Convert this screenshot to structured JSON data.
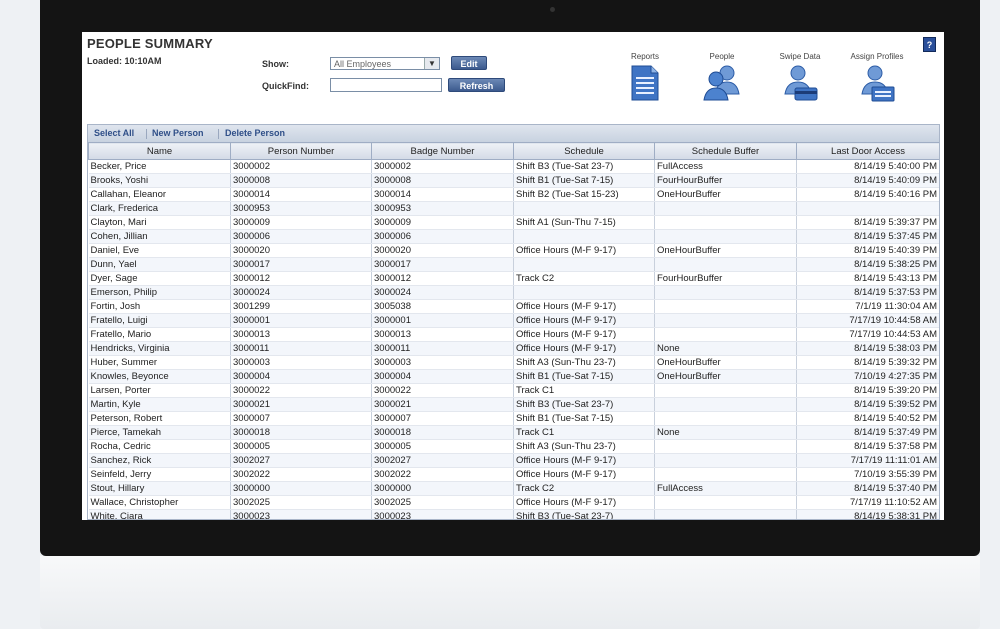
{
  "header": {
    "title": "PEOPLE SUMMARY",
    "loaded": "Loaded: 10:10AM"
  },
  "filters": {
    "show_label": "Show:",
    "show_value": "All Employees",
    "edit_label": "Edit",
    "quickfind_label": "QuickFind:",
    "quickfind_value": "",
    "refresh_label": "Refresh"
  },
  "nav": [
    {
      "label": "Reports",
      "icon": "reports-icon"
    },
    {
      "label": "People",
      "icon": "people-icon"
    },
    {
      "label": "Swipe Data",
      "icon": "swipe-data-icon"
    },
    {
      "label": "Assign Profiles",
      "icon": "assign-profiles-icon"
    }
  ],
  "help_label": "?",
  "toolbar": {
    "select_all": "Select All",
    "new_person": "New Person",
    "delete_person": "Delete Person"
  },
  "table": {
    "columns": [
      "Name",
      "Person Number",
      "Badge Number",
      "Schedule",
      "Schedule Buffer",
      "Last Door Access"
    ],
    "rows": [
      [
        "Becker, Price",
        "3000002",
        "3000002",
        "Shift B3 (Tue-Sat 23-7)",
        "FullAccess",
        "8/14/19 5:40:00 PM"
      ],
      [
        "Brooks, Yoshi",
        "3000008",
        "3000008",
        "Shift B1 (Tue-Sat 7-15)",
        "FourHourBuffer",
        "8/14/19 5:40:09 PM"
      ],
      [
        "Callahan, Eleanor",
        "3000014",
        "3000014",
        "Shift B2 (Tue-Sat 15-23)",
        "OneHourBuffer",
        "8/14/19 5:40:16 PM"
      ],
      [
        "Clark, Frederica",
        "3000953",
        "3000953",
        "",
        "",
        ""
      ],
      [
        "Clayton, Mari",
        "3000009",
        "3000009",
        "Shift A1 (Sun-Thu 7-15)",
        "",
        "8/14/19 5:39:37 PM"
      ],
      [
        "Cohen, Jillian",
        "3000006",
        "3000006",
        "",
        "",
        "8/14/19 5:37:45 PM"
      ],
      [
        "Daniel, Eve",
        "3000020",
        "3000020",
        "Office Hours (M-F 9-17)",
        "OneHourBuffer",
        "8/14/19 5:40:39 PM"
      ],
      [
        "Dunn, Yael",
        "3000017",
        "3000017",
        "",
        "",
        "8/14/19 5:38:25 PM"
      ],
      [
        "Dyer, Sage",
        "3000012",
        "3000012",
        "Track C2",
        "FourHourBuffer",
        "8/14/19 5:43:13 PM"
      ],
      [
        "Emerson, Philip",
        "3000024",
        "3000024",
        "",
        "",
        "8/14/19 5:37:53 PM"
      ],
      [
        "Fortin, Josh",
        "3001299",
        "3005038",
        "Office Hours (M-F 9-17)",
        "",
        "7/1/19 11:30:04 AM"
      ],
      [
        "Fratello, Luigi",
        "3000001",
        "3000001",
        "Office Hours (M-F 9-17)",
        "",
        "7/17/19 10:44:58 AM"
      ],
      [
        "Fratello, Mario",
        "3000013",
        "3000013",
        "Office Hours (M-F 9-17)",
        "",
        "7/17/19 10:44:53 AM"
      ],
      [
        "Hendricks, Virginia",
        "3000011",
        "3000011",
        "Office Hours (M-F 9-17)",
        "None",
        "8/14/19 5:38:03 PM"
      ],
      [
        "Huber, Summer",
        "3000003",
        "3000003",
        "Shift A3 (Sun-Thu 23-7)",
        "OneHourBuffer",
        "8/14/19 5:39:32 PM"
      ],
      [
        "Knowles, Beyonce",
        "3000004",
        "3000004",
        "Shift B1 (Tue-Sat 7-15)",
        "OneHourBuffer",
        "7/10/19 4:27:35 PM"
      ],
      [
        "Larsen, Porter",
        "3000022",
        "3000022",
        "Track C1",
        "",
        "8/14/19 5:39:20 PM"
      ],
      [
        "Martin, Kyle",
        "3000021",
        "3000021",
        "Shift B3 (Tue-Sat 23-7)",
        "",
        "8/14/19 5:39:52 PM"
      ],
      [
        "Peterson, Robert",
        "3000007",
        "3000007",
        "Shift B1 (Tue-Sat 7-15)",
        "",
        "8/14/19 5:40:52 PM"
      ],
      [
        "Pierce, Tamekah",
        "3000018",
        "3000018",
        "Track C1",
        "None",
        "8/14/19 5:37:49 PM"
      ],
      [
        "Rocha, Cedric",
        "3000005",
        "3000005",
        "Shift A3 (Sun-Thu 23-7)",
        "",
        "8/14/19 5:37:58 PM"
      ],
      [
        "Sanchez, Rick",
        "3002027",
        "3002027",
        "Office Hours (M-F 9-17)",
        "",
        "7/17/19 11:11:01 AM"
      ],
      [
        "Seinfeld, Jerry",
        "3002022",
        "3002022",
        "Office Hours (M-F 9-17)",
        "",
        "7/10/19 3:55:39 PM"
      ],
      [
        "Stout, Hillary",
        "3000000",
        "3000000",
        "Track C2",
        "FullAccess",
        "8/14/19 5:37:40 PM"
      ],
      [
        "Wallace, Christopher",
        "3002025",
        "3002025",
        "Office Hours (M-F 9-17)",
        "",
        "7/17/19 11:10:52 AM"
      ],
      [
        "White, Ciara",
        "3000023",
        "3000023",
        "Shift B3 (Tue-Sat 23-7)",
        "",
        "8/14/19 5:38:31 PM"
      ]
    ]
  },
  "colors": {
    "accent": "#2f4f88",
    "button": "#4a6ba0",
    "header_bg": "#dfe5ee"
  }
}
